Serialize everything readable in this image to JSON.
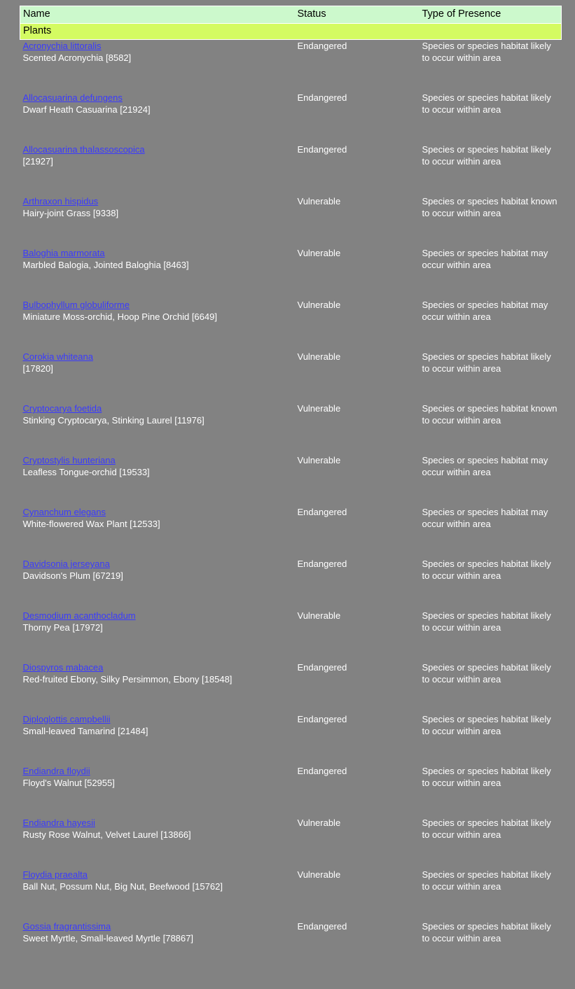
{
  "colors": {
    "page_background": "#828282",
    "header_background": "#ccf9cc",
    "group_row_background": "#d4fb62",
    "link_color": "#3a3aff",
    "body_text_color": "#ffffff",
    "header_text_color": "#000000"
  },
  "table": {
    "columns": [
      {
        "key": "name",
        "label": "Name"
      },
      {
        "key": "status",
        "label": "Status"
      },
      {
        "key": "presence",
        "label": "Type of Presence"
      }
    ],
    "group_label": "Plants",
    "rows": [
      {
        "scientific_name": "Acronychia littoralis",
        "common_name": "Scented Acronychia [8582]",
        "status": "Endangered",
        "presence": "Species or species habitat likely to occur within area"
      },
      {
        "scientific_name": "Allocasuarina defungens",
        "common_name": "Dwarf Heath Casuarina [21924]",
        "status": "Endangered",
        "presence": "Species or species habitat likely to occur within area"
      },
      {
        "scientific_name": "Allocasuarina thalassoscopica",
        "common_name": " [21927]",
        "status": "Endangered",
        "presence": "Species or species habitat likely to occur within area"
      },
      {
        "scientific_name": "Arthraxon hispidus",
        "common_name": "Hairy-joint Grass [9338]",
        "status": "Vulnerable",
        "presence": "Species or species habitat known to occur within area"
      },
      {
        "scientific_name": "Baloghia marmorata",
        "common_name": "Marbled Balogia, Jointed Baloghia [8463]",
        "status": "Vulnerable",
        "presence": "Species or species habitat may occur within area"
      },
      {
        "scientific_name": "Bulbophyllum globuliforme",
        "common_name": "Miniature Moss-orchid, Hoop Pine Orchid [6649]",
        "status": "Vulnerable",
        "presence": "Species or species habitat may occur within area"
      },
      {
        "scientific_name": "Corokia whiteana",
        "common_name": " [17820]",
        "status": "Vulnerable",
        "presence": "Species or species habitat likely to occur within area"
      },
      {
        "scientific_name": "Cryptocarya foetida",
        "common_name": "Stinking Cryptocarya, Stinking Laurel [11976]",
        "status": "Vulnerable",
        "presence": "Species or species habitat known to occur within area"
      },
      {
        "scientific_name": "Cryptostylis hunteriana",
        "common_name": "Leafless Tongue-orchid [19533]",
        "status": "Vulnerable",
        "presence": "Species or species habitat may occur within area"
      },
      {
        "scientific_name": "Cynanchum elegans",
        "common_name": "White-flowered Wax Plant [12533]",
        "status": "Endangered",
        "presence": "Species or species habitat may occur within area"
      },
      {
        "scientific_name": "Davidsonia jerseyana",
        "common_name": "Davidson's Plum [67219]",
        "status": "Endangered",
        "presence": "Species or species habitat likely to occur within area"
      },
      {
        "scientific_name": "Desmodium acanthocladum",
        "common_name": "Thorny Pea [17972]",
        "status": "Vulnerable",
        "presence": "Species or species habitat likely to occur within area"
      },
      {
        "scientific_name": "Diospyros mabacea",
        "common_name": "Red-fruited Ebony, Silky Persimmon, Ebony [18548]",
        "status": "Endangered",
        "presence": "Species or species habitat likely to occur within area"
      },
      {
        "scientific_name": "Diploglottis campbellii",
        "common_name": "Small-leaved Tamarind [21484]",
        "status": "Endangered",
        "presence": "Species or species habitat likely to occur within area"
      },
      {
        "scientific_name": "Endiandra floydii",
        "common_name": "Floyd's Walnut [52955]",
        "status": "Endangered",
        "presence": "Species or species habitat likely to occur within area"
      },
      {
        "scientific_name": "Endiandra hayesii",
        "common_name": "Rusty Rose Walnut, Velvet Laurel [13866]",
        "status": "Vulnerable",
        "presence": "Species or species habitat likely to occur within area"
      },
      {
        "scientific_name": "Floydia praealta",
        "common_name": "Ball Nut, Possum Nut, Big Nut, Beefwood [15762]",
        "status": "Vulnerable",
        "presence": "Species or species habitat likely to occur within area"
      },
      {
        "scientific_name": "Gossia fragrantissima",
        "common_name": "Sweet Myrtle, Small-leaved Myrtle [78867]",
        "status": "Endangered",
        "presence": "Species or species habitat likely to occur within area"
      }
    ]
  }
}
